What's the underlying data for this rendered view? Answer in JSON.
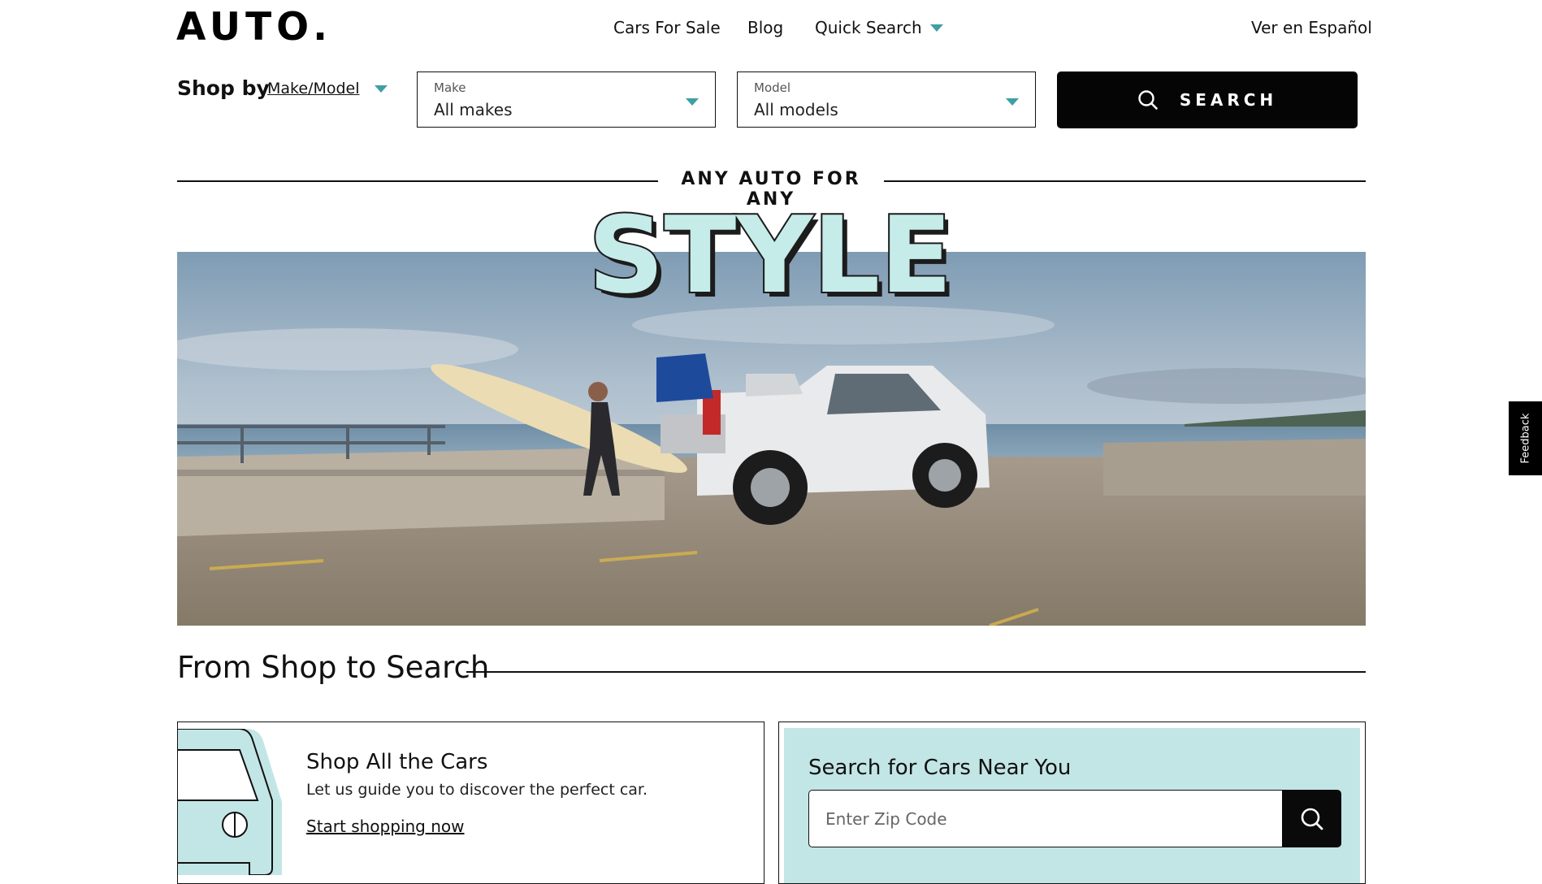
{
  "header": {
    "logo": "AUTO.",
    "nav": {
      "cars_for_sale": "Cars For Sale",
      "blog": "Blog",
      "quick_search": "Quick Search"
    },
    "language_link": "Ver en Español"
  },
  "shop_by": {
    "label": "Shop by",
    "mode": "Make/Model",
    "make": {
      "label": "Make",
      "value": "All makes"
    },
    "model": {
      "label": "Model",
      "value": "All models"
    },
    "search_button": "SEARCH"
  },
  "hero": {
    "tagline": "ANY AUTO FOR ANY",
    "headline": "STYLE"
  },
  "section": {
    "title": "From Shop to Search"
  },
  "card_shop": {
    "title": "Shop All the Cars",
    "description": "Let us guide you to discover the perfect car.",
    "link": "Start shopping now"
  },
  "card_search": {
    "title": "Search for Cars Near You",
    "zip_placeholder": "Enter Zip Code"
  },
  "feedback_tab": "Feedback",
  "colors": {
    "accent": "#3f9fa3",
    "mint": "#c2e6e5",
    "dark": "#050505"
  }
}
